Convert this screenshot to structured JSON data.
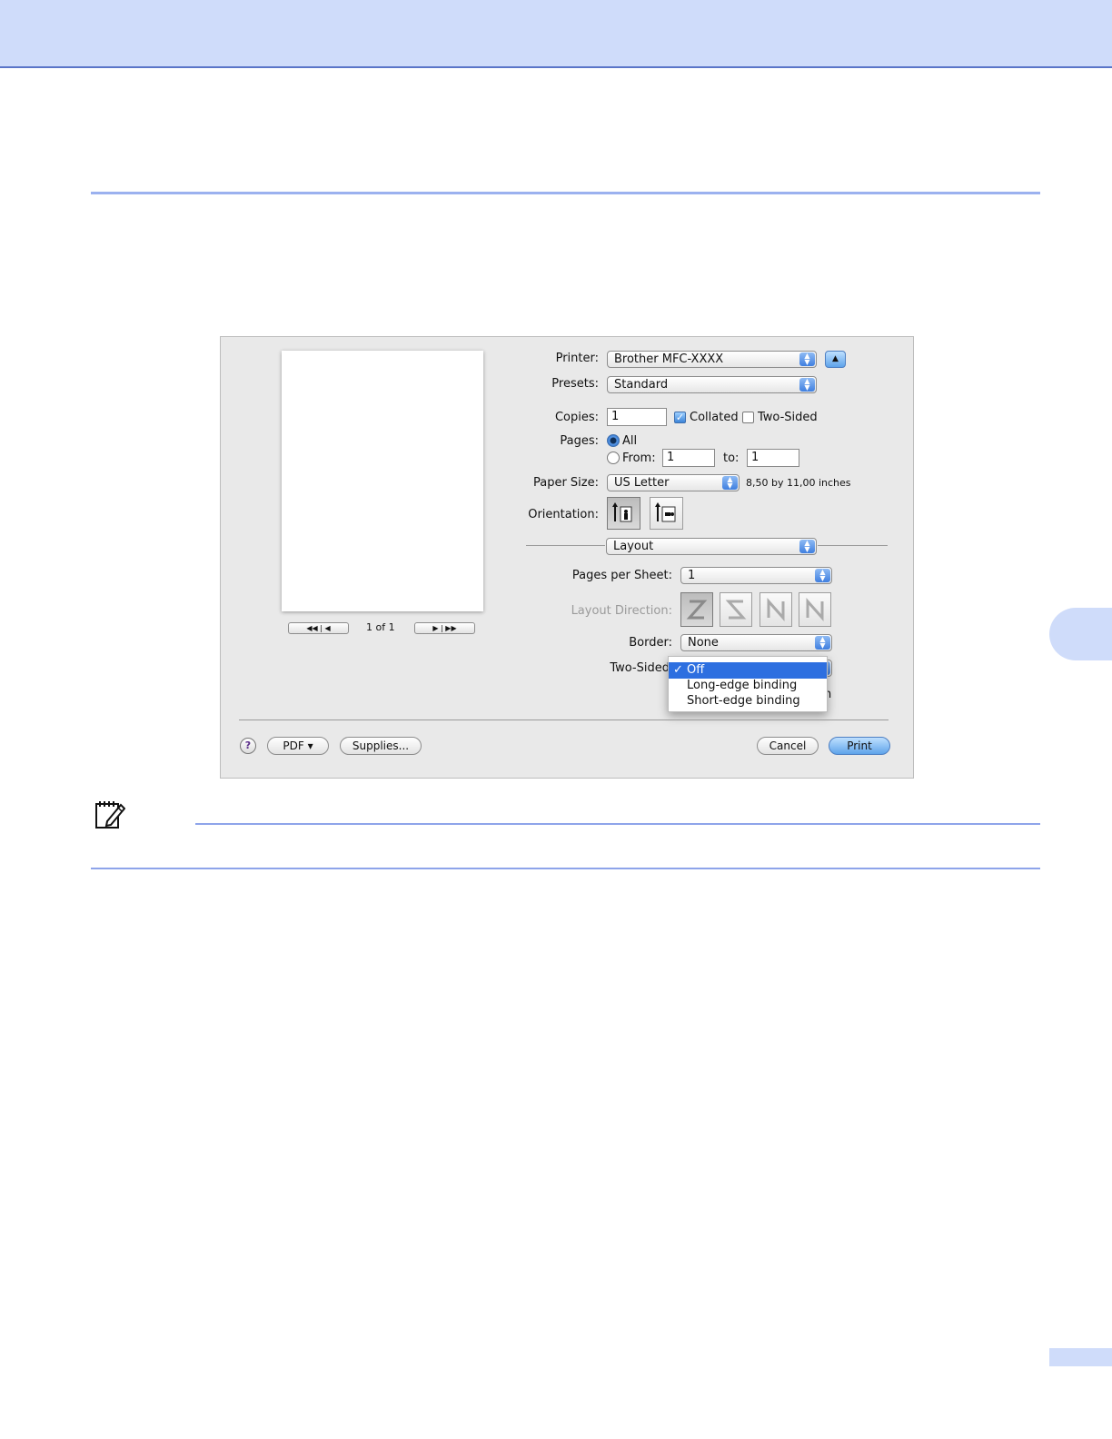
{
  "colors": {
    "band": "#cfdcfa",
    "rule": "#9bb1ef",
    "accent": "#2d6fe0"
  },
  "dialog": {
    "preview": {
      "page_counter": "1 of 1",
      "first_prev_icons": "first-prev-icon",
      "next_last_icons": "next-last-icon"
    },
    "printer": {
      "label": "Printer:",
      "value": "Brother MFC-XXXX"
    },
    "presets": {
      "label": "Presets:",
      "value": "Standard"
    },
    "copies": {
      "label": "Copies:",
      "value": "1",
      "collated_label": "Collated",
      "collated_checked": true,
      "two_sided_label": "Two-Sided",
      "two_sided_checked": false
    },
    "pages": {
      "label": "Pages:",
      "all_label": "All",
      "all_selected": true,
      "from_label": "From:",
      "from_value": "1",
      "to_label": "to:",
      "to_value": "1"
    },
    "paper_size": {
      "label": "Paper Size:",
      "value": "US Letter",
      "dimensions": "8,50 by 11,00 inches"
    },
    "orientation": {
      "label": "Orientation:",
      "selected": "portrait"
    },
    "section_popup": "Layout",
    "pages_per_sheet": {
      "label": "Pages per Sheet:",
      "value": "1"
    },
    "layout_direction": {
      "label": "Layout Direction:"
    },
    "border": {
      "label": "Border:",
      "value": "None"
    },
    "two_sided": {
      "label": "Two-Sided",
      "options": [
        {
          "label": "Off",
          "selected": true,
          "check": "✓"
        },
        {
          "label": "Long-edge binding",
          "selected": false,
          "check": ""
        },
        {
          "label": "Short-edge binding",
          "selected": false,
          "check": ""
        }
      ],
      "hidden_tail": "n"
    },
    "footer": {
      "help": "?",
      "pdf": "PDF ▾",
      "supplies": "Supplies...",
      "cancel": "Cancel",
      "print": "Print"
    }
  }
}
